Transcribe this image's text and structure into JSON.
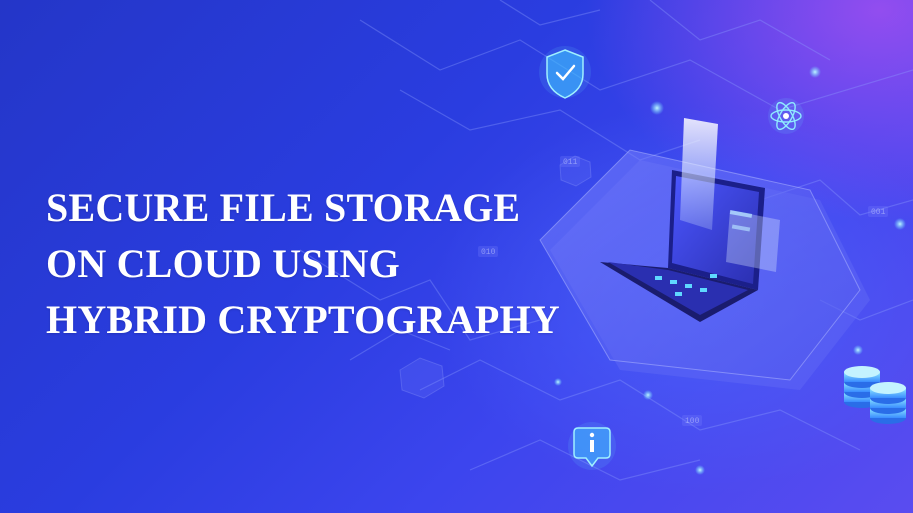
{
  "title": {
    "line1": "SECURE FILE STORAGE",
    "line2": "ON CLOUD USING",
    "line3": "HYBRID CRYPTOGRAPHY"
  },
  "binary_tags": [
    "011",
    "010",
    "001",
    "100"
  ],
  "icons": [
    "shield-check-icon",
    "atom-icon",
    "info-icon",
    "database-stack-icon",
    "laptop-icon"
  ],
  "colors": {
    "background_start": "#2436c8",
    "background_end": "#5a4cf0",
    "glow_purple": "#b050f0",
    "accent_cyan": "#6fe3ff",
    "headline": "#ffffff"
  }
}
